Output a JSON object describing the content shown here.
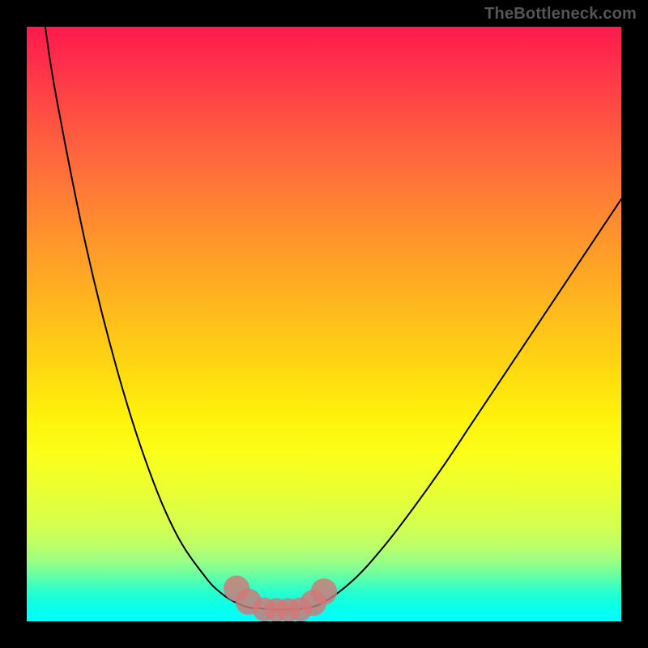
{
  "watermark": "TheBottleneck.com",
  "colors": {
    "frame_bg": "#000000",
    "curve_stroke": "#000000",
    "marker_fill": "#d27777",
    "gradient_top": "#ff1a4b",
    "gradient_mid": "#fff30b",
    "gradient_bottom": "#00ffff",
    "watermark": "#555555"
  },
  "chart_data": {
    "type": "line",
    "title": "",
    "xlabel": "",
    "ylabel": "",
    "xlim": [
      0,
      100
    ],
    "ylim": [
      0,
      100
    ],
    "grid": false,
    "legend_position": "none",
    "series": [
      {
        "name": "left-curve",
        "x": [
          3.1,
          5,
          10,
          15,
          20,
          25,
          30,
          33,
          35.5,
          37.5,
          39
        ],
        "values": [
          100,
          88,
          63,
          43,
          27,
          15,
          7.5,
          4.5,
          3.0,
          2.3,
          2.2
        ]
      },
      {
        "name": "flat-segment",
        "x": [
          39,
          41,
          43,
          45,
          47
        ],
        "values": [
          2.2,
          2.0,
          2.0,
          2.0,
          2.2
        ]
      },
      {
        "name": "right-curve",
        "x": [
          47,
          50,
          55,
          60,
          65,
          70,
          75,
          80,
          85,
          90,
          95,
          100
        ],
        "values": [
          2.2,
          3.2,
          7,
          12.5,
          19,
          26,
          33.5,
          41,
          48.5,
          56,
          63.5,
          71
        ]
      }
    ],
    "markers": [
      {
        "name": "left-marker-upper",
        "x": 35.3,
        "y": 5.5,
        "r": 2.2
      },
      {
        "name": "left-marker-lower",
        "x": 37.3,
        "y": 3.3,
        "r": 2.2
      },
      {
        "name": "right-marker-upper",
        "x": 50.0,
        "y": 5.0,
        "r": 2.2
      },
      {
        "name": "right-marker-lower",
        "x": 48.2,
        "y": 3.1,
        "r": 2.2
      },
      {
        "name": "flat-marker-a",
        "x": 40.0,
        "y": 2.0,
        "r": 2.0
      },
      {
        "name": "flat-marker-b",
        "x": 42.0,
        "y": 1.9,
        "r": 2.0
      },
      {
        "name": "flat-marker-c",
        "x": 44.0,
        "y": 1.9,
        "r": 2.0
      },
      {
        "name": "flat-marker-d",
        "x": 46.0,
        "y": 2.0,
        "r": 2.0
      }
    ]
  }
}
